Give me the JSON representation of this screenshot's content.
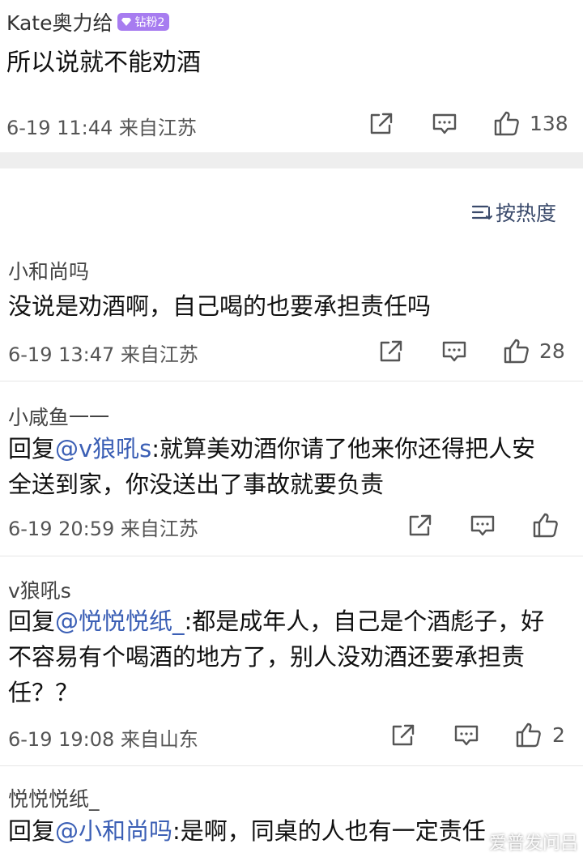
{
  "top_comment": {
    "username": "Kate奥力给",
    "badge": {
      "label": "钻粉2",
      "icon": "diamond-icon",
      "color": "#a77cf0"
    },
    "text": "所以说就不能劝酒",
    "meta": "6-19 11:44 来自江苏",
    "actions": {
      "share_icon": "share-icon",
      "comment_icon": "comment-icon",
      "like_icon": "thumbs-up-icon",
      "likes": "138"
    }
  },
  "sort": {
    "icon": "sort-icon",
    "label": "按热度"
  },
  "replies": [
    {
      "name": "小和尚吗",
      "lines": [
        [
          {
            "t": "没说是劝酒啊，自己喝的也要承担责任吗",
            "mention": false
          }
        ]
      ],
      "meta": "6-19 13:47 来自江苏",
      "likes": "28"
    },
    {
      "name": "小咸鱼一一",
      "lines": [
        [
          {
            "t": "回复",
            "mention": false
          },
          {
            "t": "@v狼吼s",
            "mention": true
          },
          {
            "t": ":就算美劝酒你请了他来你还得把人安",
            "mention": false
          }
        ],
        [
          {
            "t": "全送到家，你没送出了事故就要负责",
            "mention": false
          }
        ]
      ],
      "meta": "6-19 20:59 来自江苏",
      "likes": ""
    },
    {
      "name": "v狼吼s",
      "lines": [
        [
          {
            "t": "回复",
            "mention": false
          },
          {
            "t": "@悦悦悦纸_",
            "mention": true
          },
          {
            "t": ":都是成年人，自己是个酒彪子，好",
            "mention": false
          }
        ],
        [
          {
            "t": "不容易有个喝酒的地方了，别人没劝酒还要承担责",
            "mention": false
          }
        ],
        [
          {
            "t": "任？？",
            "mention": false
          }
        ]
      ],
      "meta": "6-19 19:08 来自山东",
      "likes": "2"
    },
    {
      "name": "悦悦悦纸_",
      "lines": [
        [
          {
            "t": "回复",
            "mention": false
          },
          {
            "t": "@小和尚吗",
            "mention": true
          },
          {
            "t": ":是啊，同桌的人也有一定责任",
            "mention": false
          }
        ]
      ],
      "meta": "",
      "likes": ""
    }
  ],
  "watermark": "爱普发问吕",
  "colors": {
    "mention": "#3b5fb5",
    "separator": "#eeeeee",
    "meta": "#555555"
  }
}
